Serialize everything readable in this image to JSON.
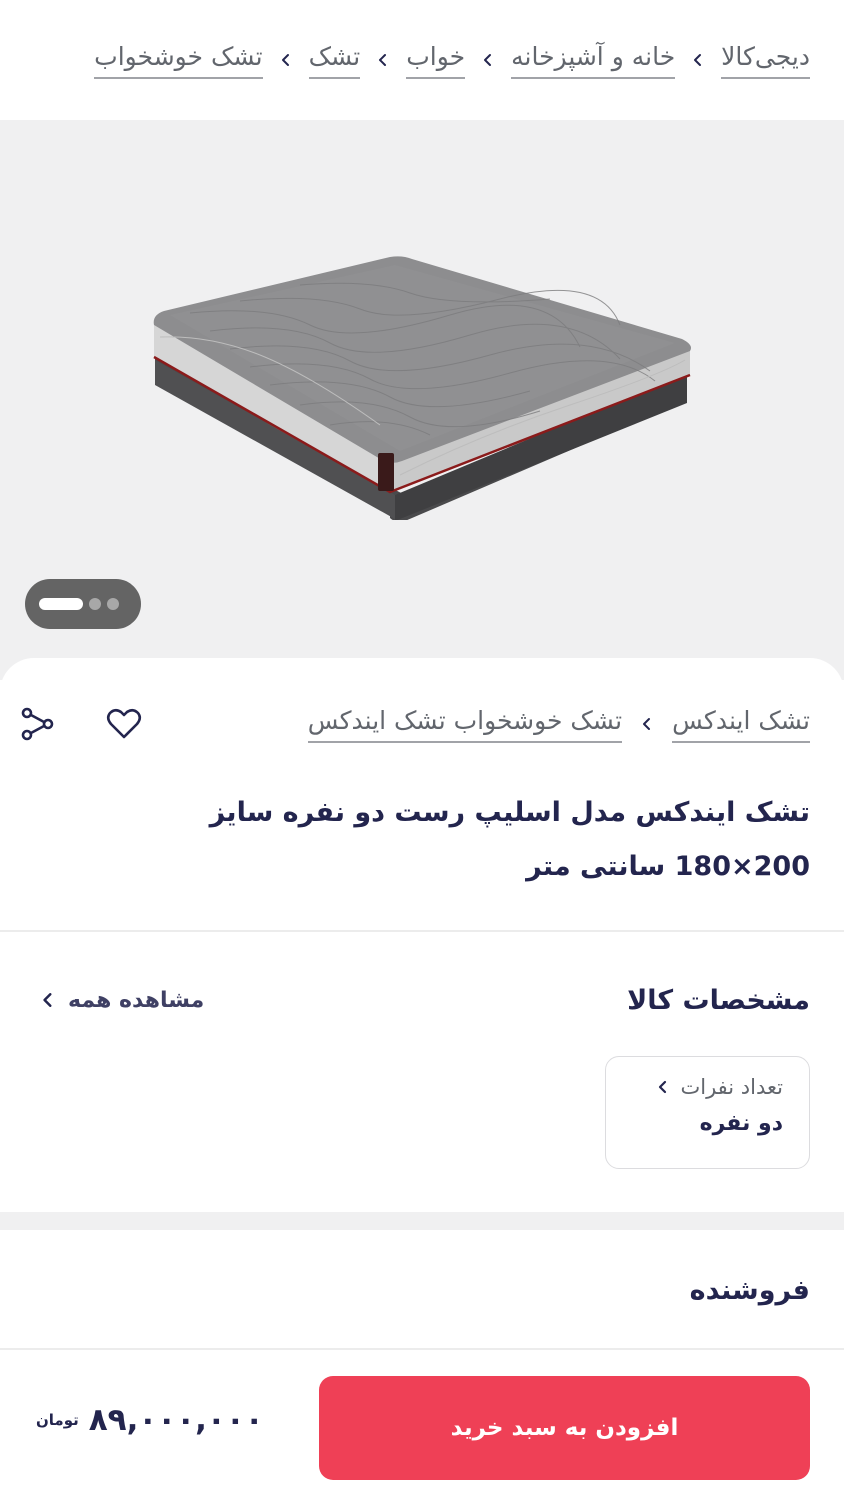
{
  "breadcrumb": {
    "items": [
      "دیجی‌کالا",
      "خانه و آشپزخانه",
      "خواب",
      "تشک",
      "تشک خوشخواب"
    ]
  },
  "gallery": {
    "image_icon": "mattress-image",
    "active_slide": 1,
    "total_slides": 3
  },
  "product": {
    "brand_crumbs": [
      "تشک ایندکس",
      "تشک خوشخواب تشک ایندکس"
    ],
    "title": "تشک ایندکس مدل اسلیپ رست دو نفره سایز 200×180 سانتی متر"
  },
  "specs": {
    "title": "مشخصات کالا",
    "see_all": "مشاهده همه",
    "items": [
      {
        "label": "تعداد نفرات",
        "value": "دو نفره"
      }
    ]
  },
  "seller": {
    "title": "فروشنده"
  },
  "purchase": {
    "button_label": "افزودن به سبد خرید",
    "price": "۸۹,۰۰۰,۰۰۰",
    "currency": "تومان"
  },
  "colors": {
    "accent": "#ef4056",
    "text": "#23254e",
    "muted": "#62666d"
  }
}
